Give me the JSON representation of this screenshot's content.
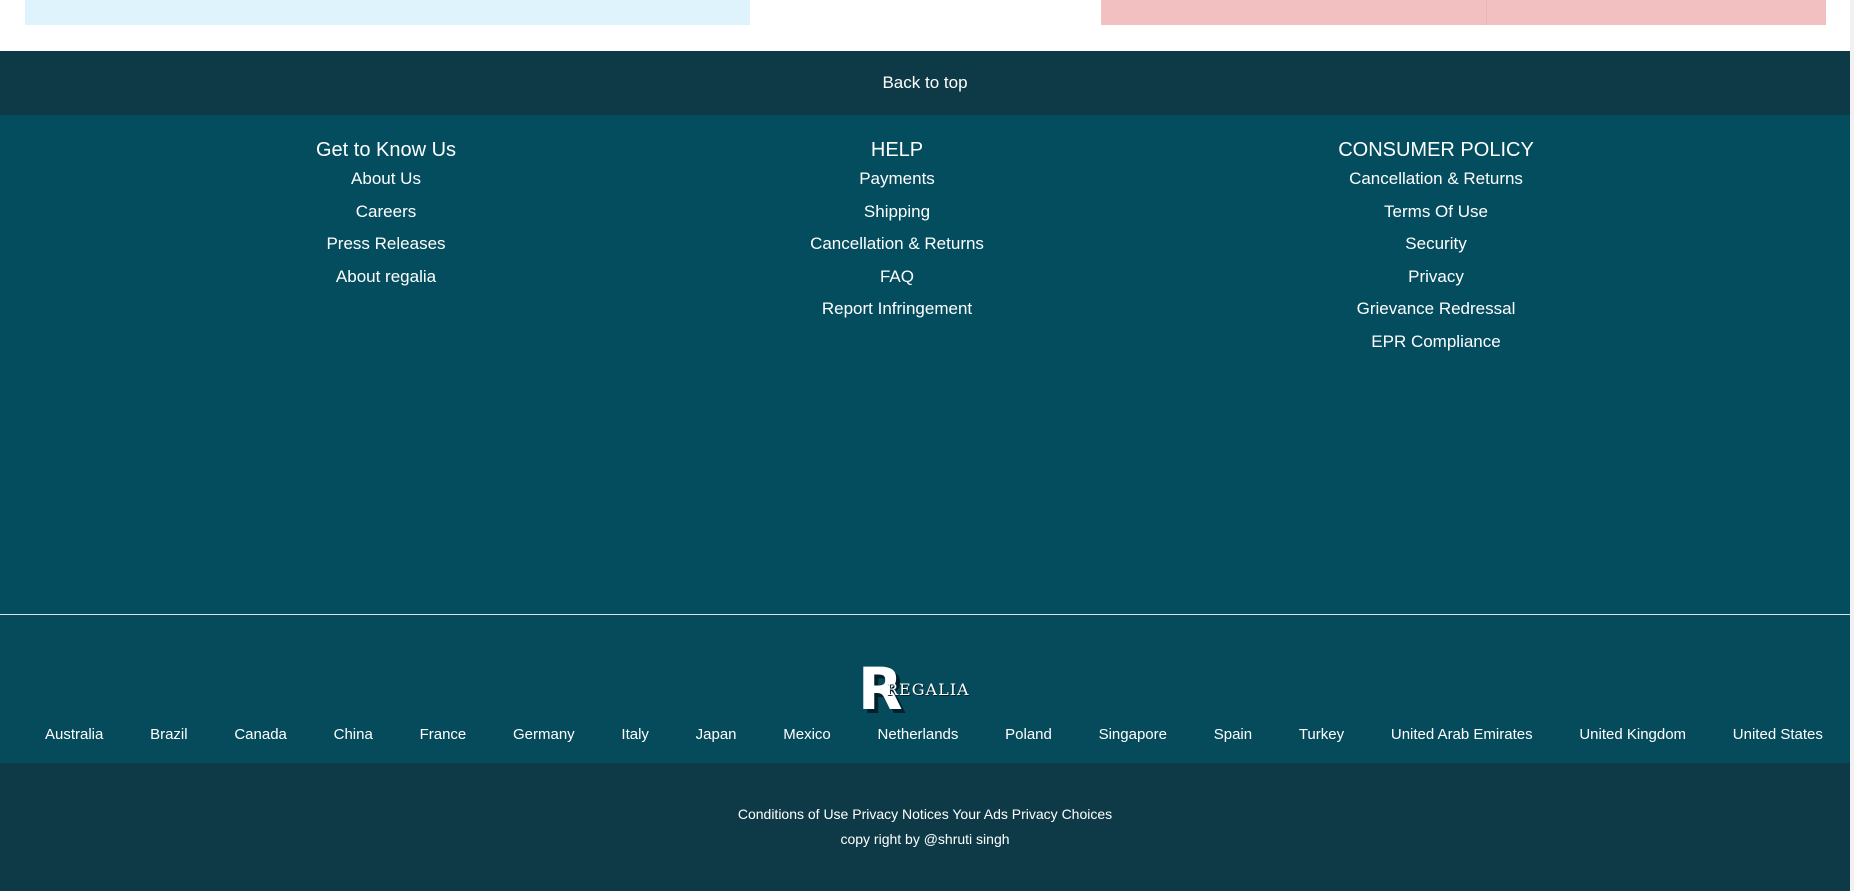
{
  "back_to_top": {
    "label": "Back to top"
  },
  "columns": [
    {
      "title": "Get to Know Us",
      "links": [
        "About Us",
        "Careers",
        "Press Releases",
        "About regalia"
      ]
    },
    {
      "title": "HELP",
      "links": [
        "Payments",
        "Shipping",
        "Cancellation & Returns",
        "FAQ",
        "Report Infringement"
      ]
    },
    {
      "title": "CONSUMER POLICY",
      "links": [
        "Cancellation & Returns",
        "Terms Of Use",
        "Security",
        "Privacy",
        "Grievance Redressal",
        "EPR Compliance"
      ]
    }
  ],
  "logo": {
    "letter": "R",
    "word": "REGALIA"
  },
  "countries": [
    "Australia",
    "Brazil",
    "Canada",
    "China",
    "France",
    "Germany",
    "Italy",
    "Japan",
    "Mexico",
    "Netherlands",
    "Poland",
    "Singapore",
    "Spain",
    "Turkey",
    "United Arab Emirates",
    "United Kingdom",
    "United States"
  ],
  "legal": {
    "links": [
      "Conditions of Use",
      "Privacy Notices",
      "Your Ads Privacy Choices"
    ],
    "copyright": "copy right by @shruti singh"
  },
  "colors": {
    "back_to_top_bg": "#0e3a47",
    "footer_bg": "#034d5f",
    "banner_left": "#dff3fd",
    "banner_right": "#f2c0c1"
  }
}
